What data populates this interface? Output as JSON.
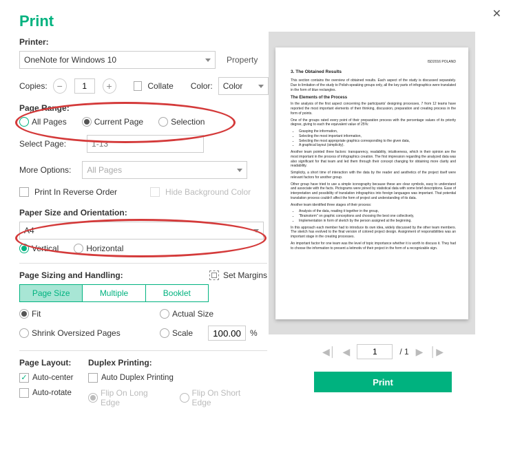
{
  "title": "Print",
  "printer": {
    "label": "Printer:",
    "value": "OneNote for Windows 10",
    "property": "Property"
  },
  "copies": {
    "label": "Copies:",
    "value": "1"
  },
  "collate": "Collate",
  "color": {
    "label": "Color:",
    "value": "Color"
  },
  "pageRange": {
    "label": "Page Range:",
    "all": "All Pages",
    "current": "Current Page",
    "selection": "Selection"
  },
  "selectPage": {
    "label": "Select Page:",
    "placeholder": "1-13"
  },
  "moreOptions": {
    "label": "More Options:",
    "value": "All Pages"
  },
  "reverse": "Print In Reverse Order",
  "hideBg": "Hide Background Color",
  "paper": {
    "label": "Paper Size and Orientation:",
    "value": "A4",
    "vertical": "Vertical",
    "horizontal": "Horizontal"
  },
  "sizing": {
    "label": "Page Sizing and Handling:",
    "setMargins": "Set Margins"
  },
  "tabs": {
    "size": "Page Size",
    "multiple": "Multiple",
    "booklet": "Booklet"
  },
  "fit": "Fit",
  "actual": "Actual Size",
  "shrink": "Shrink Oversized Pages",
  "scale": "Scale",
  "scaleVal": "100.00",
  "pct": "%",
  "layout": {
    "label": "Page Layout:",
    "autoCenter": "Auto-center",
    "autoRotate": "Auto-rotate"
  },
  "duplex": {
    "label": "Duplex Printing:",
    "auto": "Auto Duplex Printing",
    "long": "Flip On Long Edge",
    "short": "Flip On Short Edge"
  },
  "pager": {
    "current": "1",
    "total": "/ 1"
  },
  "printBtn": "Print",
  "preview": {
    "headerRight": "ISD2016 POLAND",
    "h3": "3.  The Obtained Results",
    "p1": "This section contains the overview of obtained results. Each aspect of the study is discussed separately. Due to limitation of the study to Polish-speaking groups only, all the key parts of infographics were translated in the form of blue rectangles.",
    "h4a": "The Elements of the Process",
    "p2": "In the analysis of the first aspect concerning the participants' designing processes, 7 from 12 teams have reported the most important elements of their thinking, discussion, preparation and creating process in the form of points.",
    "p3": "One of the groups rated every point of their preparation process with the percentage values of its priority degree, giving to each the equivalent value of 25%:",
    "b1": "Grasping the information,",
    "b2": "Selecting the most important information,",
    "b3": "Selecting the most appropriate graphics corresponding to the given data,",
    "b4": "A graphical layout (simplicity).",
    "p4": "Another team pointed three factors: transparency, readability, intuitiveness, which in their opinion are the most important in the process of infographics creation. The first impression regarding the analyzed data was also significant for that team and led them through their concept changing for obtaining more clarity and readability.",
    "p5": "Simplicity, a short time of interaction with the data by the reader and aesthetics of the project itself were relevant factors for another group.",
    "p6": "Other group have tried to use a simple iconography because these are clear symbols, easy to understand and associate with the facts. Pictograms were joined by statistical data with some brief descriptions. Ease of interpretation and possibility of translation infographics into foreign languages was important. That potential translation process couldn't affect the form of project and understanding of its data.",
    "p7": "Another team identified three stages of their process:",
    "b5": "Analysis of the data, reading it together in the group,",
    "b6": "\"Brainstorm\" on graphic conceptions and choosing the best one collectively,",
    "b7": "Implementation in form of sketch by the person assigned at the beginning.",
    "p8": "In this approach each member had to introduce its own idea, widely discussed by the other team members. The sketch has evolved to the final version of colored project design. Assignment of responsibilities was an important stage in the creating processes.",
    "p9": "An important factor for one team was the level of topic importance whether it is worth to discuss it. They had to choose the information to present a leitmotiv of their project in the form of a recognizable sign."
  }
}
